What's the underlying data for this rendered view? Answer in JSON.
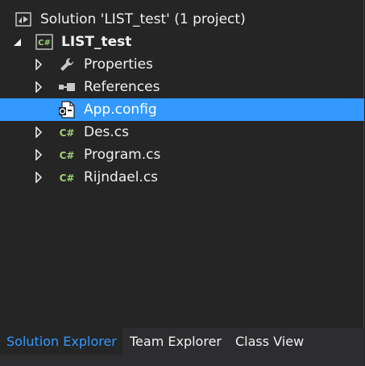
{
  "tree": {
    "solution_label": "Solution 'LIST_test' (1 project)",
    "project_label": "LIST_test",
    "items": [
      {
        "label": "Properties"
      },
      {
        "label": "References"
      },
      {
        "label": "App.config"
      },
      {
        "label": "Des.cs"
      },
      {
        "label": "Program.cs"
      },
      {
        "label": "Rijndael.cs"
      }
    ],
    "project_icon_text": "C#",
    "cs_icon_text": "C#"
  },
  "tabs": [
    {
      "label": "Solution Explorer"
    },
    {
      "label": "Team Explorer"
    },
    {
      "label": "Class View"
    }
  ],
  "colors": {
    "background": "#252526",
    "selection": "#3399ff",
    "text": "#f1f1f1",
    "cs_icon_green": "#9fd175"
  }
}
